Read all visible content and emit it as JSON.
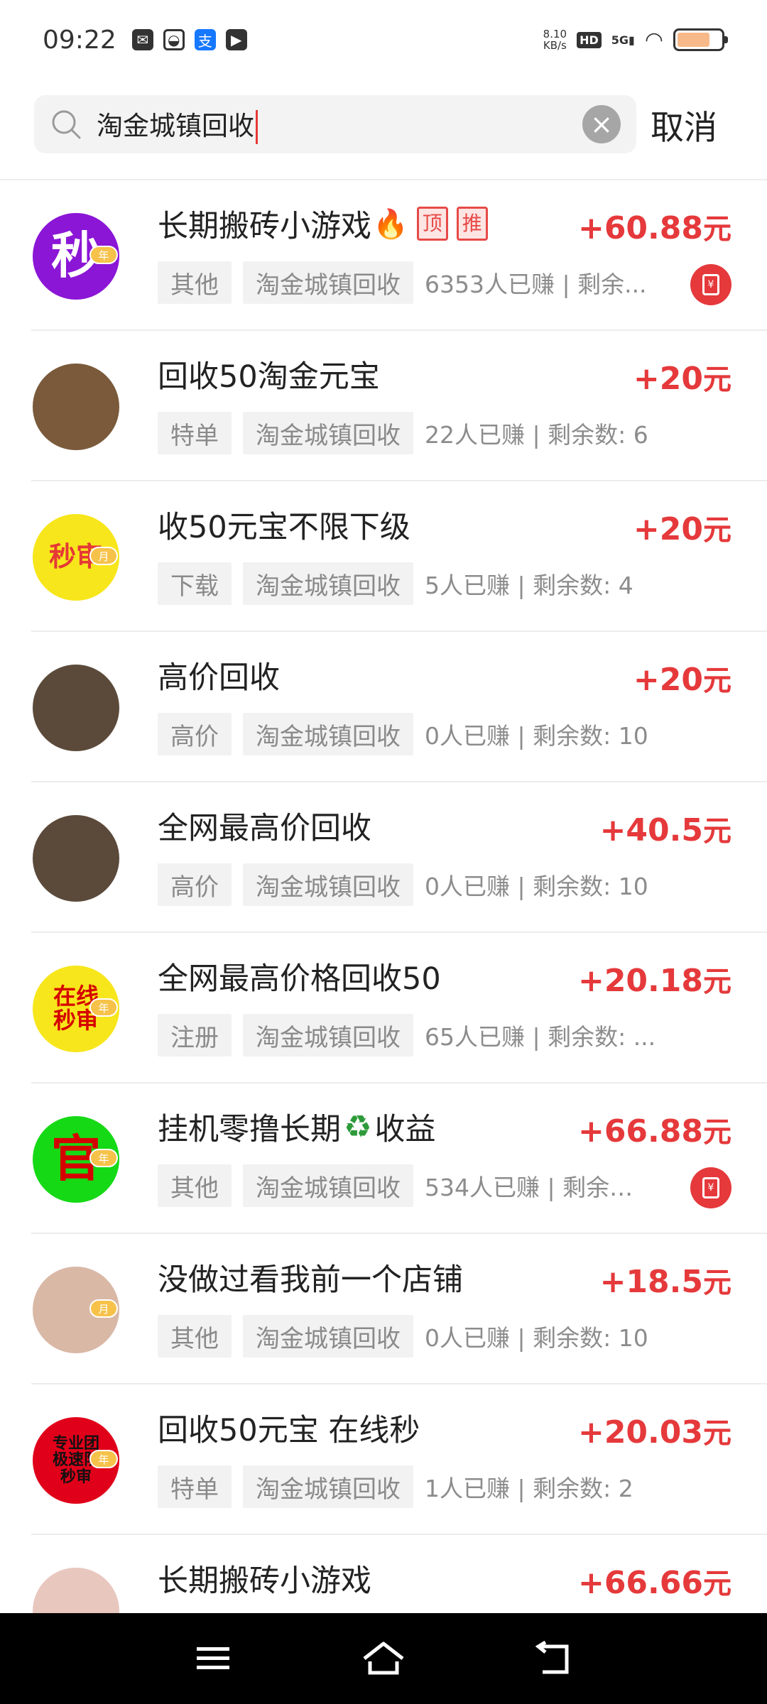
{
  "status_bar": {
    "time": "09:22",
    "speed_value": "8.10",
    "speed_unit": "KB/s",
    "hd": "HD",
    "network": "5G",
    "battery_level": 0.75
  },
  "search": {
    "value": "淘金城镇回收",
    "cancel_label": "取消"
  },
  "items": [
    {
      "title": "长期搬砖小游戏",
      "fire": true,
      "tag_ding": "顶",
      "tag_tui": "推",
      "price": "+60.88",
      "unit": "元",
      "tag1": "其他",
      "tag2": "淘金城镇回收",
      "stats": "6353人已赚 | 剩余...",
      "redpack": true,
      "avatar_text": "秒",
      "avatar_bg": "#8b16d6",
      "avatar_color": "#ffffff",
      "badge": "年"
    },
    {
      "title": "回收50淘金元宝",
      "price": "+20",
      "unit": "元",
      "tag1": "特单",
      "tag2": "淘金城镇回收",
      "stats": "22人已赚 | 剩余数: 6",
      "avatar_text": "",
      "avatar_bg": "#7a5a3a",
      "avatar_color": "#ffffff",
      "badge": ""
    },
    {
      "title": "收50元宝不限下级",
      "price": "+20",
      "unit": "元",
      "tag1": "下载",
      "tag2": "淘金城镇回收",
      "stats": "5人已赚 | 剩余数: 4",
      "avatar_text": "秒审",
      "avatar_bg": "#f7e61b",
      "avatar_color": "#e53935",
      "badge": "月"
    },
    {
      "title": "高价回收",
      "price": "+20",
      "unit": "元",
      "tag1": "高价",
      "tag2": "淘金城镇回收",
      "stats": "0人已赚 | 剩余数: 10",
      "avatar_text": "",
      "avatar_bg": "#5b4a3a",
      "avatar_color": "#ffffff",
      "badge": ""
    },
    {
      "title": "全网最高价回收",
      "price": "+40.5",
      "unit": "元",
      "tag1": "高价",
      "tag2": "淘金城镇回收",
      "stats": "0人已赚 | 剩余数: 10",
      "avatar_text": "",
      "avatar_bg": "#5b4a3a",
      "avatar_color": "#ffffff",
      "badge": ""
    },
    {
      "title": "全网最高价格回收50",
      "price": "+20.18",
      "unit": "元",
      "tag1": "注册",
      "tag2": "淘金城镇回收",
      "stats": "65人已赚 | 剩余数: ...",
      "avatar_text": "在线秒审",
      "avatar_bg": "#f7e61b",
      "avatar_color": "#d50000",
      "badge": "年"
    },
    {
      "title": "挂机零撸长期",
      "recycle": true,
      "title_suffix": "收益",
      "price": "+66.88",
      "unit": "元",
      "tag1": "其他",
      "tag2": "淘金城镇回收",
      "stats": "534人已赚 | 剩余数...",
      "redpack": true,
      "avatar_text": "官",
      "avatar_bg": "#16d916",
      "avatar_color": "#d50000",
      "badge": "年"
    },
    {
      "title": "没做过看我前一个店铺",
      "price": "+18.5",
      "unit": "元",
      "tag1": "其他",
      "tag2": "淘金城镇回收",
      "stats": "0人已赚 | 剩余数: 10",
      "avatar_text": "",
      "avatar_bg": "#d9b8a6",
      "avatar_color": "#ffffff",
      "badge": "月"
    },
    {
      "title": "回收50元宝 在线秒",
      "price": "+20.03",
      "unit": "元",
      "tag1": "特单",
      "tag2": "淘金城镇回收",
      "stats": "1人已赚 | 剩余数: 2",
      "avatar_text": "专业团极速队秒审",
      "avatar_bg": "#e0001a",
      "avatar_color": "#111111",
      "badge": "年"
    },
    {
      "title": "长期搬砖小游戏",
      "price": "+66.66",
      "unit": "元",
      "tag1": "",
      "tag2": "",
      "stats": "",
      "avatar_text": "",
      "avatar_bg": "#e8c7bf",
      "avatar_color": "#ffffff",
      "badge": ""
    }
  ]
}
